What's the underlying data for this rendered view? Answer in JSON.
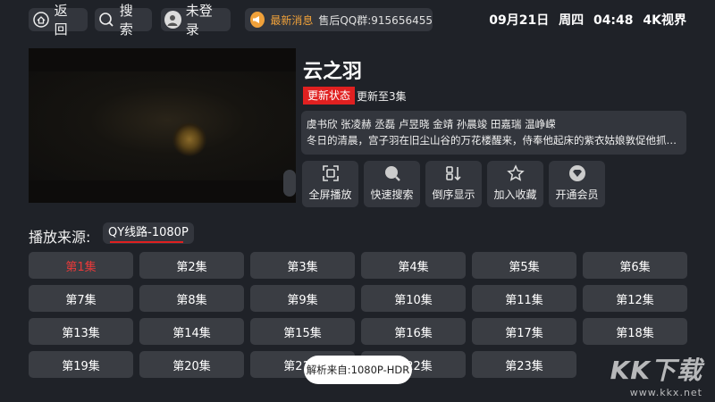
{
  "topbar": {
    "back_label": "返回",
    "search_label": "搜索",
    "login_label": "未登录",
    "news_label": "最新消息",
    "news_text": "售后QQ群:915656455",
    "date": "09月21日",
    "weekday": "周四",
    "time": "04:48",
    "brand": "4K视界"
  },
  "video": {
    "title": "云之羽",
    "status_badge": "更新状态",
    "status_text": "更新至3集",
    "cast": "虞书欣 张凌赫 丞磊 卢昱晓 金靖 孙晨竣 田嘉瑞 温峥嵘",
    "synopsis": "冬日的清晨，宫子羽在旧尘山谷的万花楼醒来，侍奉他起床的紫衣姑娘敦促他抓紧..."
  },
  "actions": [
    {
      "label": "全屏播放",
      "icon": "fullscreen-icon"
    },
    {
      "label": "快速搜索",
      "icon": "search-icon"
    },
    {
      "label": "倒序显示",
      "icon": "sort-icon"
    },
    {
      "label": "加入收藏",
      "icon": "star-icon"
    },
    {
      "label": "开通会员",
      "icon": "vip-icon"
    }
  ],
  "source": {
    "label": "播放来源:",
    "selected": "QY线路-1080P"
  },
  "episodes": [
    "第1集",
    "第2集",
    "第3集",
    "第4集",
    "第5集",
    "第6集",
    "第7集",
    "第8集",
    "第9集",
    "第10集",
    "第11集",
    "第12集",
    "第13集",
    "第14集",
    "第15集",
    "第16集",
    "第17集",
    "第18集",
    "第19集",
    "第20集",
    "第21集",
    "第22集",
    "第23集"
  ],
  "active_episode": "第1集",
  "toast": "解析来自:1080P-HDR",
  "watermark": {
    "big": "KK下载",
    "small": "www.kkx.net"
  },
  "colors": {
    "accent": "#e02020",
    "background": "#1f2228",
    "tile": "#3a3d43",
    "news_accent": "#f0a13a"
  }
}
